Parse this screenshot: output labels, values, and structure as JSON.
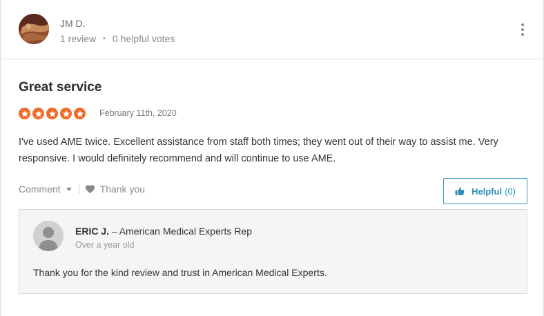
{
  "reviewer": {
    "name": "JM D.",
    "review_count": "1 review",
    "separator": "•",
    "helpful_votes": "0 helpful votes"
  },
  "review": {
    "title": "Great service",
    "rating": 5,
    "rating_max": 5,
    "date": "February 11th, 2020",
    "text": "I've used AME twice. Excellent assistance from staff both times; they went out of their way to assist me. Very responsive. I would definitely recommend and will continue to use AME."
  },
  "actions": {
    "comment_label": "Comment",
    "thank_label": "Thank you",
    "helpful_label": "Helpful",
    "helpful_count": "(0)"
  },
  "reply": {
    "author": "ERIC J.",
    "role": "– American Medical Experts Rep",
    "age": "Over a year old",
    "text": "Thank you for the kind review and trust in American Medical Experts."
  },
  "colors": {
    "star": "#f06a2a",
    "accent": "#2b8fb3",
    "reply_bg": "#f5f5f5"
  },
  "icons": {
    "menu": "kebab-menu-icon",
    "star": "star-icon",
    "thank": "heart-icon",
    "helpful": "thumbs-up-icon",
    "caret": "caret-down-icon",
    "reply_avatar": "default-user-icon"
  }
}
